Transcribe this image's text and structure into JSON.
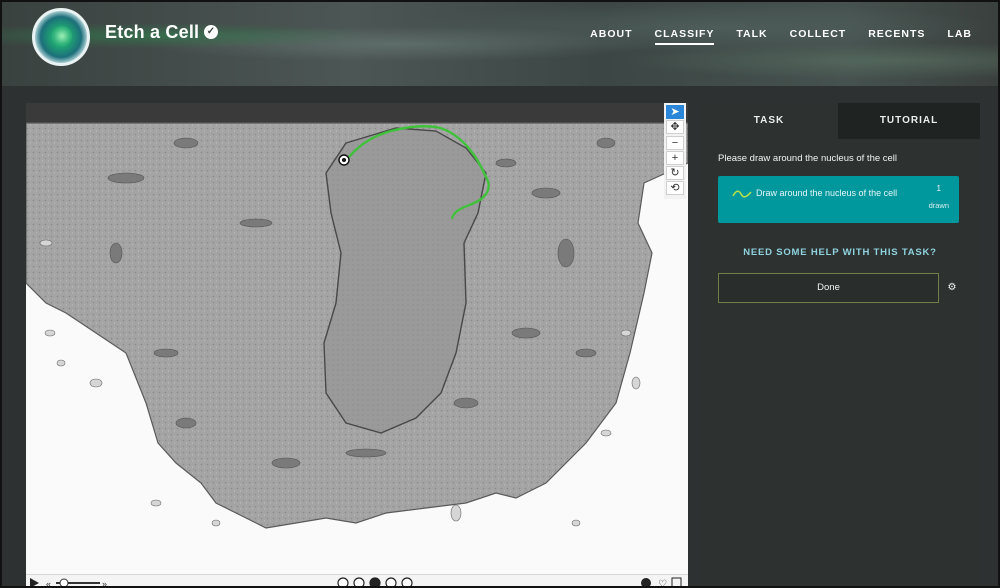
{
  "header": {
    "title": "Etch a Cell",
    "nav": [
      {
        "label": "ABOUT",
        "active": false
      },
      {
        "label": "CLASSIFY",
        "active": true
      },
      {
        "label": "TALK",
        "active": false
      },
      {
        "label": "COLLECT",
        "active": false
      },
      {
        "label": "RECENTS",
        "active": false
      },
      {
        "label": "LAB",
        "active": false
      }
    ]
  },
  "viewer": {
    "tools": [
      "cursor-icon",
      "pan-icon",
      "zoom-out-icon",
      "zoom-in-icon",
      "rotate-icon",
      "reset-icon"
    ],
    "frames": [
      1,
      2,
      3,
      4,
      5
    ],
    "current_frame": 3
  },
  "panel": {
    "tabs": {
      "task": "TASK",
      "tutorial": "TUTORIAL"
    },
    "instruction": "Please draw around the nucleus of the cell",
    "tool": {
      "label": "Draw around the nucleus of the cell",
      "count": "1",
      "status": "drawn"
    },
    "help": "NEED SOME HELP WITH THIS TASK?",
    "done": "Done"
  },
  "colors": {
    "accent": "#00979d",
    "drawing": "#3fc23a",
    "active_tool": "#2a86d9"
  }
}
